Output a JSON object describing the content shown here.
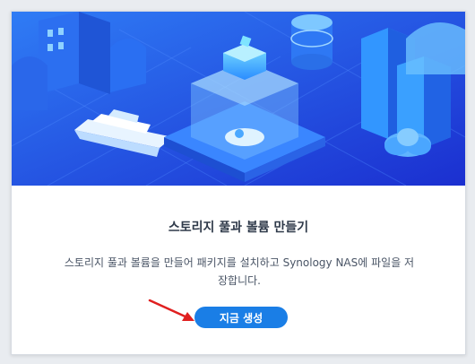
{
  "dialog": {
    "title": "스토리지 풀과 볼륨 만들기",
    "description": "스토리지 풀과 볼륨을 만들어 패키지를 설치하고 Synology NAS에 파일을 저장합니다.",
    "create_button_label": "지금 생성"
  },
  "colors": {
    "accent": "#1a7ee6",
    "hero_blue": "#1e4fe0",
    "arrow": "#e02020"
  }
}
